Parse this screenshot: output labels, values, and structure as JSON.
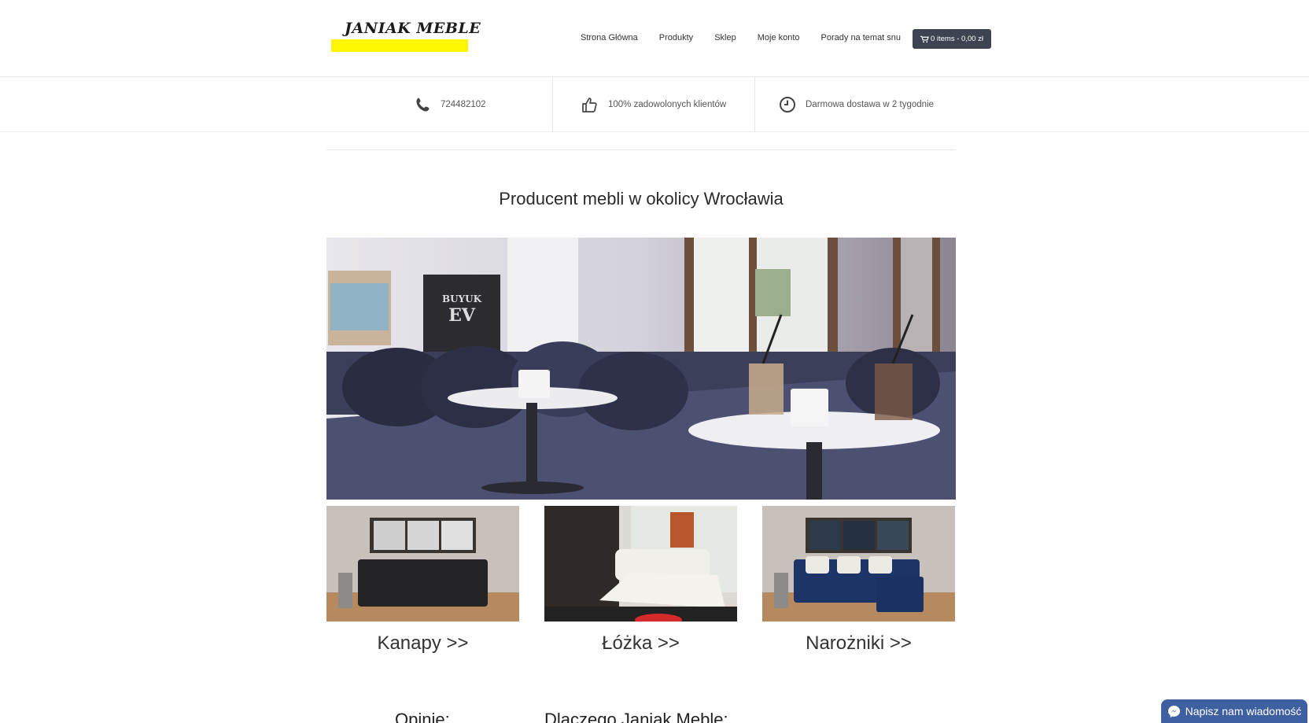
{
  "header": {
    "logo_text": "JANIAK MEBLE",
    "nav": [
      "Strona Główna",
      "Produkty",
      "Sklep",
      "Moje konto",
      "Porady na temat snu"
    ],
    "cart_label": "0 items - 0,00 zł"
  },
  "infobar": {
    "phone": "724482102",
    "satisfaction": "100% zadowolonych klientów",
    "delivery": "Darmowa dostawa w 2 tygodnie"
  },
  "main": {
    "title": "Producent mebli w okolicy Wrocławia",
    "categories": [
      {
        "label": "Kanapy >>"
      },
      {
        "label": "Łóżka >>"
      },
      {
        "label": "Narożniki >>"
      }
    ],
    "sections": [
      "Opinie:",
      "Dlaczego Janiak Meble:"
    ]
  },
  "chat": {
    "label": "Napisz nam wiadomość"
  },
  "colors": {
    "logo_highlight": "#fdf600",
    "cart_bg": "#3d4350",
    "chat_bg": "#3e5fa0"
  },
  "icons": [
    "phone-icon",
    "thumbs-up-icon",
    "clock-icon",
    "cart-icon",
    "messenger-icon"
  ]
}
